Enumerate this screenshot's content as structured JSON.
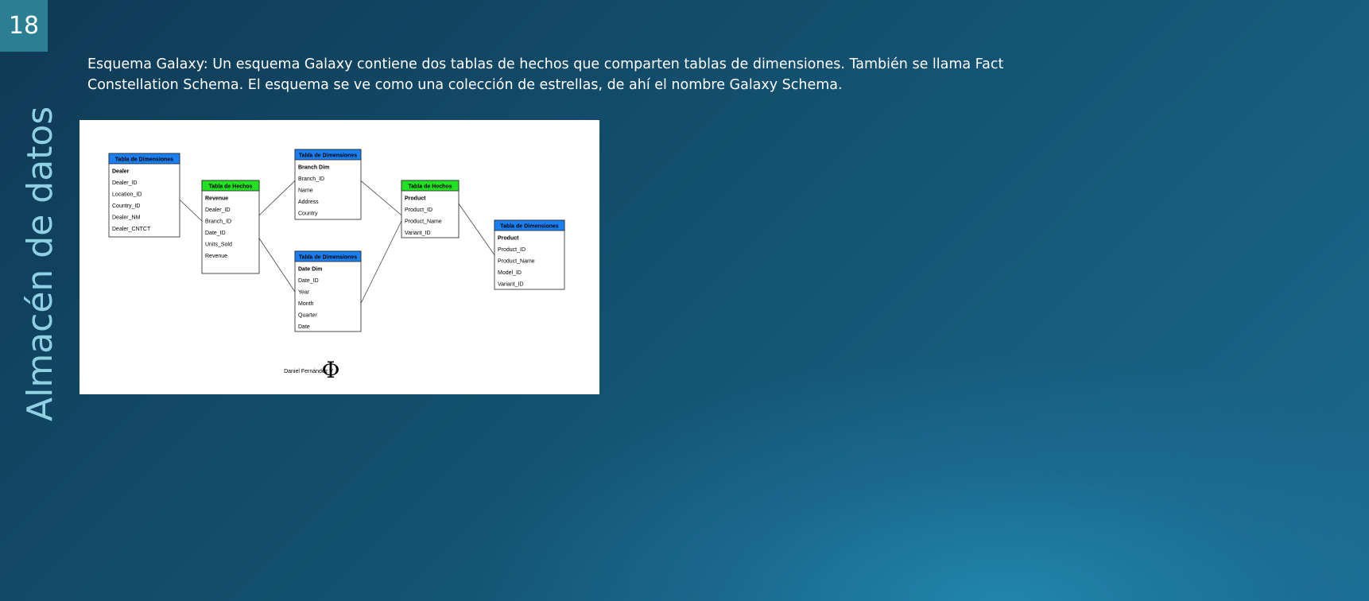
{
  "slide": {
    "number": "18",
    "section_title": "Almacén de datos",
    "body_text": "Esquema Galaxy: Un esquema Galaxy contiene dos tablas de hechos que comparten tablas de dimensiones. También se llama Fact Constellation Schema. El esquema se ve como una colección de estrellas, de ahí el nombre Galaxy Schema."
  },
  "diagram": {
    "tables": [
      {
        "id": "dealer",
        "header": "Tabla de Dimensiones",
        "kind": "dimension",
        "rows": [
          "Dealer",
          "Dealer_ID",
          "Location_ID",
          "Country_ID",
          "Dealer_NM",
          "Dealer_CNTCT"
        ]
      },
      {
        "id": "fact1",
        "header": "Tabla de Hechos",
        "kind": "fact",
        "rows": [
          "Revenue",
          "Dealer_ID",
          "Branch_ID",
          "Date_ID",
          "Units_Sold",
          "Revenue"
        ]
      },
      {
        "id": "branch",
        "header": "Tabla de Dimensiones",
        "kind": "dimension",
        "rows": [
          "Branch Dim",
          "Branch_ID",
          "Name",
          "Address",
          "Country"
        ]
      },
      {
        "id": "date",
        "header": "Tabla de Dimensiones",
        "kind": "dimension",
        "rows": [
          "Date Dim",
          "Date_ID",
          "Year",
          "Month",
          "Quarter",
          "Date"
        ]
      },
      {
        "id": "fact2",
        "header": "Tabla de Hechos",
        "kind": "fact",
        "rows": [
          "Product",
          "Product_ID",
          "Product_Name",
          "Variant_ID"
        ]
      },
      {
        "id": "product",
        "header": "Tabla de Dimensiones",
        "kind": "dimension",
        "rows": [
          "Product",
          "Product_ID",
          "Product_Name",
          "Model_ID",
          "Variant_ID"
        ]
      }
    ],
    "links": [
      [
        "dealer",
        "fact1"
      ],
      [
        "fact1",
        "branch"
      ],
      [
        "fact1",
        "date"
      ],
      [
        "branch",
        "fact2"
      ],
      [
        "date",
        "fact2"
      ],
      [
        "fact2",
        "product"
      ]
    ],
    "colors": {
      "dimension_header": "#1a7ff0",
      "fact_header": "#22e022"
    },
    "signature_text": "Daniel Fernández V",
    "signature_symbol": "Φ"
  }
}
